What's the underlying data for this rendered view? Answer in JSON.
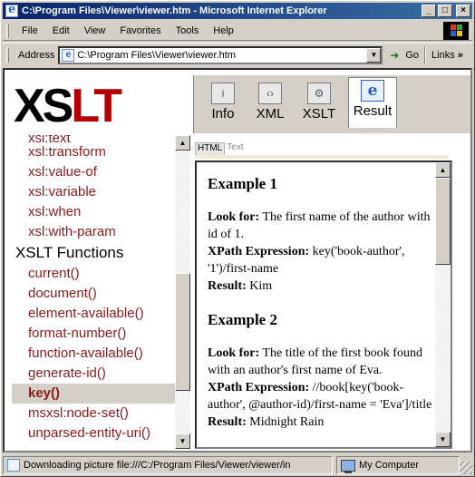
{
  "window": {
    "title": "C:\\Program Files\\Viewer\\viewer.htm - Microsoft Internet Explorer",
    "min_label": "_",
    "max_label": "□",
    "close_label": "×"
  },
  "menu": [
    {
      "label": "File"
    },
    {
      "label": "Edit"
    },
    {
      "label": "View"
    },
    {
      "label": "Favorites"
    },
    {
      "label": "Tools"
    },
    {
      "label": "Help"
    }
  ],
  "address": {
    "label": "Address",
    "value": "C:\\Program Files\\Viewer\\viewer.htm",
    "go_label": "Go",
    "links_label": "Links",
    "links_chevron": "»"
  },
  "logo": {
    "text_a": "XS",
    "text_b": "LT"
  },
  "view_tabs": [
    {
      "label": "Info",
      "icon": "info-icon",
      "glyph": "i"
    },
    {
      "label": "XML",
      "icon": "xml-icon",
      "glyph": "‹›"
    },
    {
      "label": "XSLT",
      "icon": "gear-icon",
      "glyph": "⚙"
    },
    {
      "label": "Result",
      "icon": "ie-result-icon",
      "glyph": "e"
    }
  ],
  "nav": {
    "top_partial": "xsl:text",
    "items_a": [
      "xsl:transform",
      "xsl:value-of",
      "xsl:variable",
      "xsl:when",
      "xsl:with-param"
    ],
    "heading": "XSLT Functions",
    "items_b": [
      "current()",
      "document()",
      "element-available()",
      "format-number()",
      "function-available()",
      "generate-id()",
      "key()",
      "msxsl:node-set()",
      "unparsed-entity-uri()"
    ],
    "selected": "key()"
  },
  "result_tabs": {
    "html": "HTML",
    "text": "Text"
  },
  "result": {
    "ex1_title": "Example 1",
    "ex1_lookfor_label": "Look for:",
    "ex1_lookfor": "The first name of the author with id of 1.",
    "ex1_xpath_label": "XPath Expression:",
    "ex1_xpath": "key('book-author', '1')/first-name",
    "ex1_result_label": "Result:",
    "ex1_result": "Kim",
    "ex2_title": "Example 2",
    "ex2_lookfor_label": "Look for:",
    "ex2_lookfor": "The title of the first book found with an author's first name of Eva.",
    "ex2_xpath_label": "XPath Expression:",
    "ex2_xpath": "//book[key('book-author', @author-id)/first-name = 'Eva']/title",
    "ex2_result_label": "Result:",
    "ex2_result": "Midnight Rain"
  },
  "status": {
    "message": "Downloading picture file:///C:/Program Files/Viewer/viewer/in",
    "zone": "My Computer"
  }
}
